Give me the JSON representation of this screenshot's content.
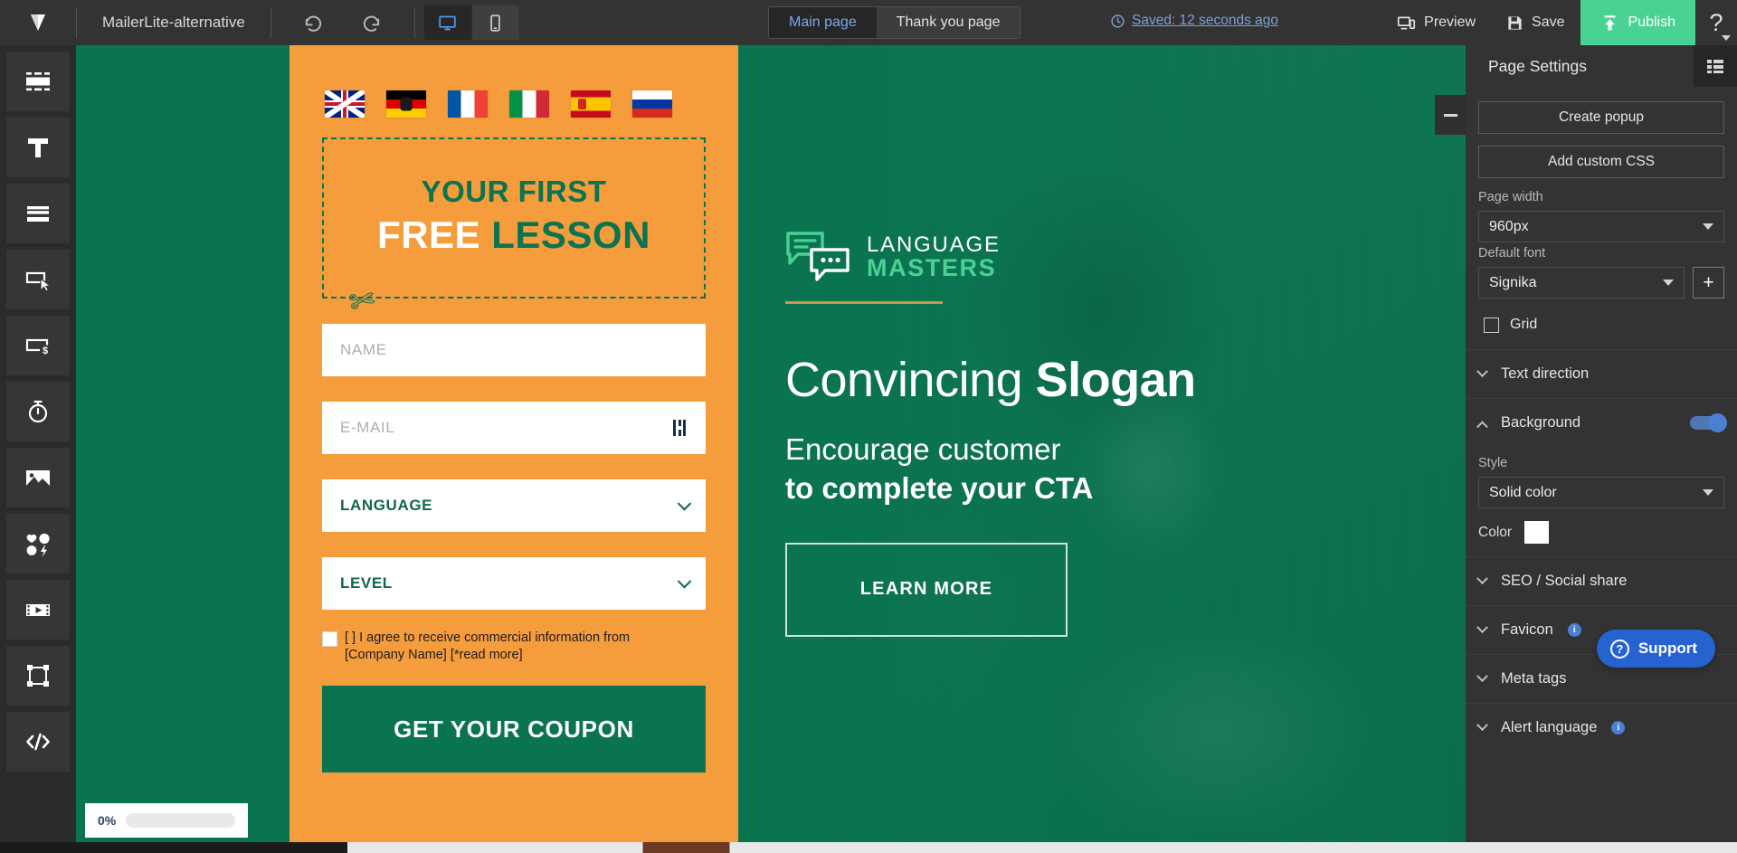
{
  "topbar": {
    "logo_icon": "mailerlite-logo-icon",
    "project_title": "MailerLite-alternative",
    "undo_icon": "undo-icon",
    "redo_icon": "redo-icon",
    "desktop_icon": "desktop-icon",
    "mobile_icon": "mobile-icon",
    "tabs": [
      {
        "label": "Main page",
        "active": true
      },
      {
        "label": "Thank you page",
        "active": false
      }
    ],
    "saved_icon": "clock-history-icon",
    "saved_label": "Saved: 12 seconds ago",
    "preview_icon": "preview-devices-icon",
    "preview_label": "Preview",
    "save_icon": "floppy-disk-icon",
    "save_label": "Save",
    "publish_icon": "upload-arrow-icon",
    "publish_label": "Publish",
    "help_label": "?",
    "publish_color": "#4ad295"
  },
  "sidebar": {
    "items": [
      {
        "icon": "section-block-icon",
        "name": "sidebar-item-section"
      },
      {
        "icon": "text-t-icon",
        "name": "sidebar-item-text"
      },
      {
        "icon": "stacked-bars-icon",
        "name": "sidebar-item-form"
      },
      {
        "icon": "button-cursor-icon",
        "name": "sidebar-item-button"
      },
      {
        "icon": "payment-card-dollar-icon",
        "name": "sidebar-item-payment"
      },
      {
        "icon": "stopwatch-timer-icon",
        "name": "sidebar-item-timer"
      },
      {
        "icon": "image-picture-icon",
        "name": "sidebar-item-image"
      },
      {
        "icon": "social-hearts-icon",
        "name": "sidebar-item-social"
      },
      {
        "icon": "video-film-icon",
        "name": "sidebar-item-video"
      },
      {
        "icon": "spacer-frame-icon",
        "name": "sidebar-item-spacer"
      },
      {
        "icon": "code-brackets-icon",
        "name": "sidebar-item-html"
      }
    ]
  },
  "canvas": {
    "collapse_icon": "minimize-dash-icon",
    "background_color": "#0a7350",
    "form_background_color": "#f59c3c",
    "flags": [
      {
        "name": "flag-uk",
        "label": "United Kingdom"
      },
      {
        "name": "flag-de",
        "label": "Germany"
      },
      {
        "name": "flag-fr",
        "label": "France"
      },
      {
        "name": "flag-it",
        "label": "Italy"
      },
      {
        "name": "flag-es",
        "label": "Spain"
      },
      {
        "name": "flag-ru",
        "label": "Russia"
      }
    ],
    "coupon": {
      "line1": "YOUR FIRST",
      "line2_white": "FREE",
      "line2_green": "LESSON",
      "scissors_icon": "scissors-icon"
    },
    "form": {
      "name_placeholder": "NAME",
      "email_placeholder": "E-MAIL",
      "email_caret_icon": "text-cursor-icon",
      "language_value": "LANGUAGE",
      "level_value": "LEVEL",
      "chevron_icon": "chevron-down-icon",
      "consent_text": "[ ] I agree to receive commercial information from [Company Name] [*read more]",
      "submit_label": "GET YOUR COUPON"
    },
    "hero": {
      "brand_icon": "speech-bubbles-icon",
      "brand_line1": "LANGUAGE",
      "brand_line2": "MASTERS",
      "rule_color": "#c89b4a",
      "headline_light": "Convincing ",
      "headline_bold": "Slogan",
      "sub_light": "Encourage customer",
      "sub_bold": "to complete your CTA",
      "button_label": "LEARN MORE"
    },
    "progress": {
      "percent_label": "0%",
      "value": 0
    }
  },
  "rightpanel": {
    "title": "Page Settings",
    "grid_toggle_icon": "list-view-icon",
    "create_popup_label": "Create popup",
    "add_custom_css_label": "Add custom CSS",
    "page_width_label": "Page width",
    "page_width_value": "960px",
    "default_font_label": "Default font",
    "default_font_value": "Signika",
    "add_font_icon": "plus-icon",
    "grid_checkbox_label": "Grid",
    "grid_checked": false,
    "sections": [
      {
        "title": "Text direction",
        "expanded": false,
        "has_info": false,
        "has_toggle": false
      },
      {
        "title": "Background",
        "expanded": true,
        "has_info": false,
        "has_toggle": true,
        "toggle_on": true
      },
      {
        "title": "SEO / Social share",
        "expanded": false,
        "has_info": false,
        "has_toggle": false
      },
      {
        "title": "Favicon",
        "expanded": false,
        "has_info": true,
        "has_toggle": false
      },
      {
        "title": "Meta tags",
        "expanded": false,
        "has_info": false,
        "has_toggle": false
      },
      {
        "title": "Alert language",
        "expanded": false,
        "has_info": true,
        "has_toggle": false
      }
    ],
    "background": {
      "style_label": "Style",
      "style_value": "Solid color",
      "color_label": "Color",
      "color_value": "#ffffff"
    },
    "support_icon": "question-circle-icon",
    "support_label": "Support",
    "support_color": "#2563d1"
  }
}
